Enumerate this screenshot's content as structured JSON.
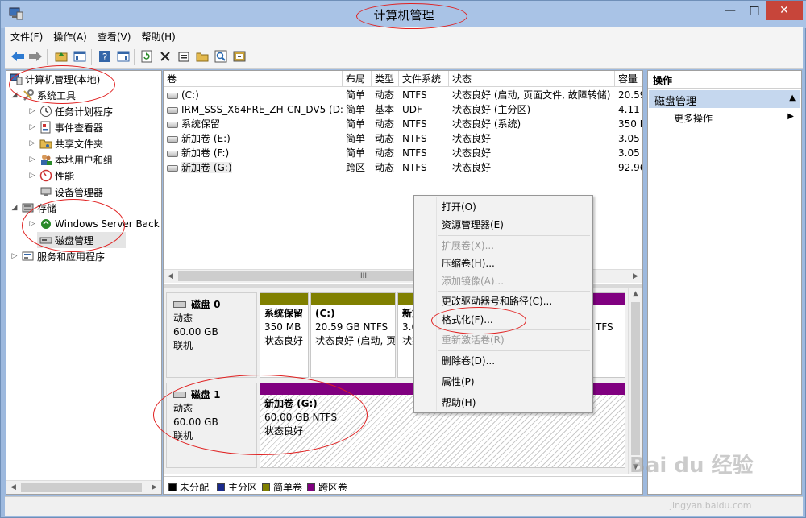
{
  "window": {
    "title": "计算机管理",
    "minimize": "—",
    "maximize": "□",
    "close": "✕"
  },
  "menu": [
    "文件(F)",
    "操作(A)",
    "查看(V)",
    "帮助(H)"
  ],
  "toolbar_icons": [
    "back-arrow-icon",
    "forward-arrow-icon",
    "up-folder-icon",
    "show-hide-tree-icon",
    "help-icon",
    "show-hide-action-pane-icon",
    "refresh-icon",
    "delete-icon",
    "properties-icon",
    "open-icon",
    "search-icon",
    "export-icon"
  ],
  "tree": {
    "root": "计算机管理(本地)",
    "system_tools": "系统工具",
    "task_scheduler": "任务计划程序",
    "event_viewer": "事件查看器",
    "shared_folders": "共享文件夹",
    "local_users": "本地用户和组",
    "performance": "性能",
    "device_manager": "设备管理器",
    "storage": "存储",
    "windows_backup": "Windows Server Back",
    "disk_management": "磁盘管理",
    "services_apps": "服务和应用程序"
  },
  "volume_table": {
    "columns": [
      "卷",
      "布局",
      "类型",
      "文件系统",
      "状态",
      "容量"
    ],
    "rows": [
      {
        "volume": "(C:)",
        "layout": "简单",
        "type": "动态",
        "fs": "NTFS",
        "status": "状态良好 (启动, 页面文件, 故障转储)",
        "capacity": "20.59"
      },
      {
        "volume": "IRM_SSS_X64FRE_ZH-CN_DV5 (D:)",
        "layout": "简单",
        "type": "基本",
        "fs": "UDF",
        "status": "状态良好 (主分区)",
        "capacity": "4.11 ("
      },
      {
        "volume": "系统保留",
        "layout": "简单",
        "type": "动态",
        "fs": "NTFS",
        "status": "状态良好 (系统)",
        "capacity": "350 M"
      },
      {
        "volume": "新加卷 (E:)",
        "layout": "简单",
        "type": "动态",
        "fs": "NTFS",
        "status": "状态良好",
        "capacity": "3.05 ("
      },
      {
        "volume": "新加卷 (F:)",
        "layout": "简单",
        "type": "动态",
        "fs": "NTFS",
        "status": "状态良好",
        "capacity": "3.05 ("
      },
      {
        "volume": "新加卷 (G:)",
        "layout": "跨区",
        "type": "动态",
        "fs": "NTFS",
        "status": "状态良好",
        "capacity": "92.96"
      }
    ],
    "scroll_thumb": "III"
  },
  "disks": [
    {
      "name": "磁盘 0",
      "type": "动态",
      "size": "60.00 GB",
      "state": "联机",
      "partitions": [
        {
          "name": "系统保留",
          "size": "350 MB",
          "status": "状态良好"
        },
        {
          "name": "(C:)",
          "size": "20.59 GB NTFS",
          "status": "状态良好 (启动, 页"
        },
        {
          "name": "新加",
          "size": "3.0",
          "status": "状态"
        },
        {
          "name": "",
          "size": "TFS",
          "status": ""
        }
      ]
    },
    {
      "name": "磁盘 1",
      "type": "动态",
      "size": "60.00 GB",
      "state": "联机",
      "partitions": [
        {
          "name": "新加卷  (G:)",
          "size": "60.00 GB NTFS",
          "status": "状态良好"
        }
      ]
    }
  ],
  "legend": [
    {
      "label": "未分配",
      "color": "#000000"
    },
    {
      "label": "主分区",
      "color": "#1a2a8c"
    },
    {
      "label": "简单卷",
      "color": "#808000"
    },
    {
      "label": "跨区卷",
      "color": "#800080"
    }
  ],
  "actions": {
    "header": "操作",
    "section": "磁盘管理",
    "more": "更多操作"
  },
  "context_menu": {
    "open": "打开(O)",
    "explorer": "资源管理器(E)",
    "extend": "扩展卷(X)...",
    "shrink": "压缩卷(H)...",
    "add_mirror": "添加镜像(A)...",
    "change_letter": "更改驱动器号和路径(C)...",
    "format": "格式化(F)...",
    "reactivate": "重新激活卷(R)",
    "delete": "删除卷(D)...",
    "properties": "属性(P)",
    "help": "帮助(H)"
  },
  "watermark": {
    "logo": "Bai du 经验",
    "url": "jingyan.baidu.com"
  },
  "colors": {
    "simple_volume": "#808000",
    "spanned_volume": "#800080",
    "annotation": "#e02020"
  }
}
